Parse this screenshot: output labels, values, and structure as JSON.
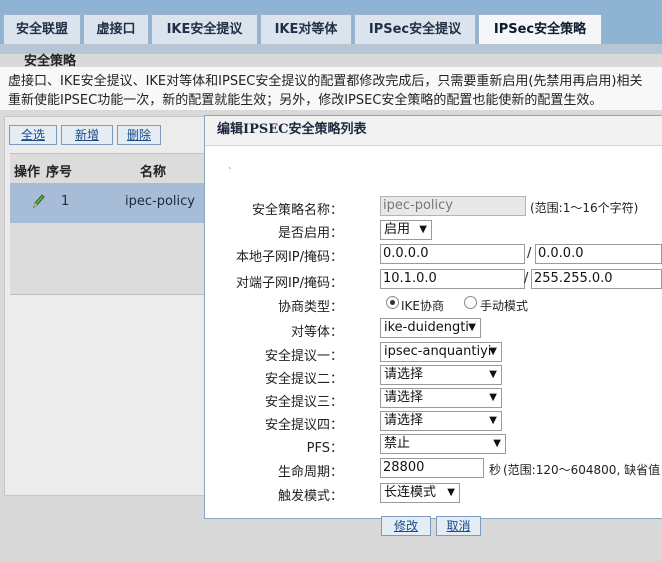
{
  "tabs": [
    {
      "label": "安全联盟",
      "active": false
    },
    {
      "label": "虚接口",
      "active": false
    },
    {
      "label": "IKE安全提议",
      "active": false
    },
    {
      "label": "IKE对等体",
      "active": false
    },
    {
      "label": "IPSec安全提议",
      "active": false
    },
    {
      "label": "IPSec安全策略",
      "active": true
    }
  ],
  "section_title": "安全策略",
  "notice": {
    "line1": "虚接口、IKE安全提议、IKE对等体和IPSEC安全提议的配置都修改完成后，只需要重新启用(先禁用再启用)相关",
    "line2": "重新使能IPSEC功能一次，新的配置就能生效；另外，修改IPSEC安全策略的配置也能使新的配置生效。"
  },
  "list": {
    "buttons": {
      "select_all": "全选",
      "add": "新增",
      "delete": "删除"
    },
    "columns": {
      "action": "操作",
      "index": "序号",
      "name": "名称"
    },
    "rows": [
      {
        "index": "1",
        "name": "ipec-policy",
        "icon": "pencil-icon"
      }
    ]
  },
  "dialog": {
    "title": "编辑IPSEC安全策略列表",
    "mark": "ˎ",
    "fields": {
      "policy_name": {
        "label": "安全策略名称：",
        "value": "ipec-policy",
        "hint": "(范围:1～16个字符)"
      },
      "enabled": {
        "label": "是否启用：",
        "value": "启用"
      },
      "local_subnet": {
        "label": "本地子网IP/掩码：",
        "ip": "0.0.0.0",
        "mask": "0.0.0.0"
      },
      "remote_subnet": {
        "label": "对端子网IP/掩码：",
        "ip": "10.1.0.0",
        "mask": "255.255.0.0"
      },
      "negotiation": {
        "label": "协商类型：",
        "option_ike": "IKE协商",
        "option_manual": "手动模式",
        "selected": "IKE协商"
      },
      "peer": {
        "label": "对等体：",
        "value": "ike-duidengti"
      },
      "proposal1": {
        "label": "安全提议一：",
        "value": "ipsec-anquantiyi"
      },
      "proposal2": {
        "label": "安全提议二：",
        "value": "请选择"
      },
      "proposal3": {
        "label": "安全提议三：",
        "value": "请选择"
      },
      "proposal4": {
        "label": "安全提议四：",
        "value": "请选择"
      },
      "pfs": {
        "label": "PFS：",
        "value": "禁止"
      },
      "lifetime": {
        "label": "生命周期：",
        "value": "28800",
        "unit": "秒",
        "hint": "(范围:120～604800, 缺省值"
      },
      "trigger": {
        "label": "触发模式：",
        "value": "长连模式"
      }
    },
    "buttons": {
      "modify": "修改",
      "cancel": "取消"
    }
  },
  "colors": {
    "tabbar": "#8fb3d3",
    "selected_row": "#a7bcd7",
    "link": "#1a4a8a"
  }
}
